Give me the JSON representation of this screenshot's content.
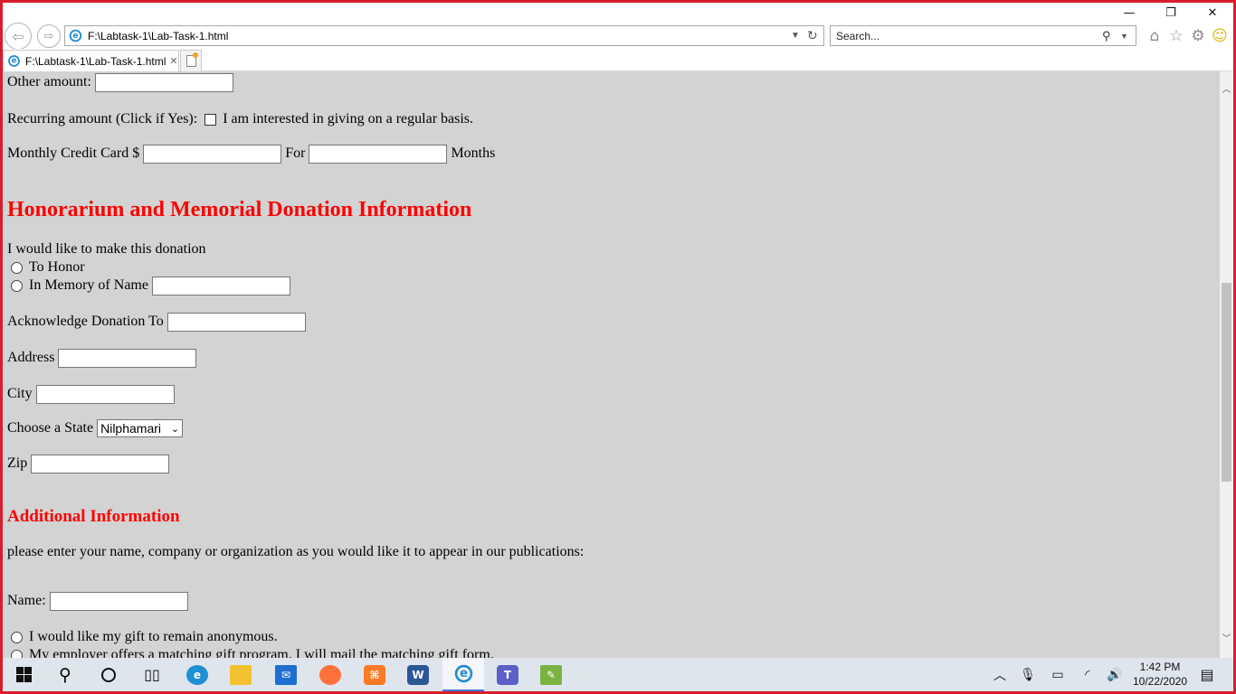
{
  "window": {
    "minimize_glyph": "—",
    "restore_glyph": "❐",
    "close_glyph": "✕"
  },
  "browser": {
    "address": "F:\\Labtask-1\\Lab-Task-1.html",
    "search_placeholder": "Search...",
    "tab_title": "F:\\Labtask-1\\Lab-Task-1.html",
    "tab_close": "✕",
    "icons": [
      "back-icon",
      "forward-icon",
      "ie-logo-icon",
      "dropdown-icon",
      "refresh-icon",
      "search-icon",
      "home-icon",
      "favorites-star-icon",
      "settings-gear-icon",
      "feedback-smiley-icon",
      "new-tab-icon"
    ]
  },
  "form": {
    "other_amount_label": "Other amount:",
    "recurring_label": "Recurring amount (Click if Yes):",
    "recurring_checkbox_text": "I am interested in giving on a regular basis.",
    "monthly_label": "Monthly Credit Card $",
    "for_label": "For",
    "months_label": "Months",
    "honorarium_heading": "Honorarium and Memorial Donation Information",
    "donation_intro": "I would like to make this donation",
    "to_honor_label": "To Honor",
    "in_memory_label": "In Memory of Name",
    "acknowledge_label": "Acknowledge Donation To",
    "address_label": "Address",
    "city_label": "City",
    "state_label": "Choose a State",
    "state_selected": "Nilphamari",
    "zip_label": "Zip",
    "additional_heading": "Additional Information",
    "publication_note": "please enter your name, company or organization as you would like it to appear in our publications:",
    "name_label": "Name:",
    "anonymous_label": "I would like my gift to remain anonymous.",
    "employer_label": "My employer offers a matching gift program. I will mail the matching gift form."
  },
  "taskbar": {
    "apps": [
      "windows-start",
      "search",
      "cortana",
      "task-view",
      "edge",
      "file-explorer",
      "mail",
      "firefox",
      "xampp",
      "word",
      "internet-explorer",
      "teams",
      "notepad-plus"
    ],
    "time": "1:42 PM",
    "date": "10/22/2020"
  },
  "colors": {
    "heading_red": "#ff0000",
    "frame_red": "#d81e2c",
    "page_background": "#d3d3d3"
  }
}
